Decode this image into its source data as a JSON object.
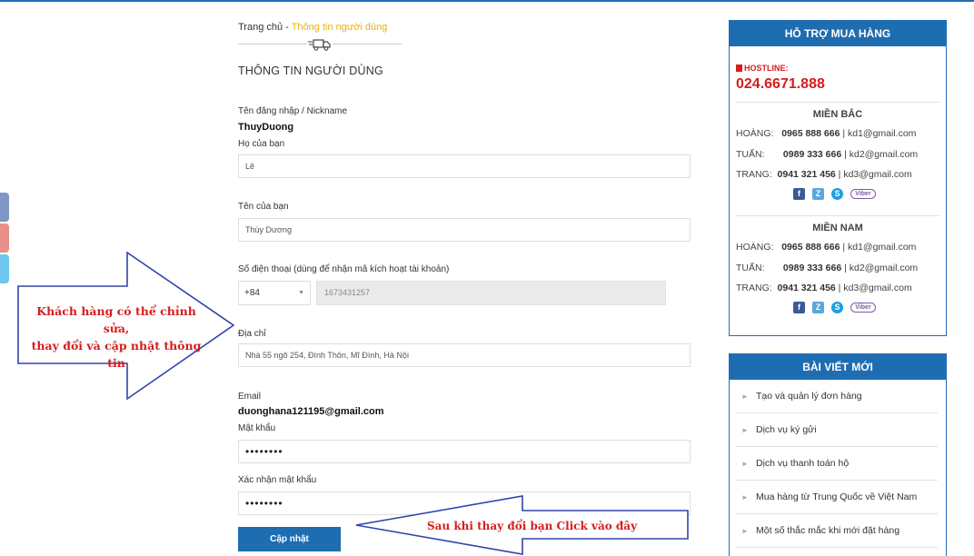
{
  "breadcrumb": {
    "home": "Trang chủ",
    "sep": " - ",
    "current": "Thông tin người dùng"
  },
  "page_title": "THÔNG TIN NGƯỜI DÙNG",
  "form": {
    "username_label": "Tên đăng nhập / Nickname",
    "username_value": "ThuyDuong",
    "lastname_label": "Họ của bạn",
    "lastname_value": "Lê",
    "firstname_label": "Tên của bạn",
    "firstname_value": "Thùy Dương",
    "phone_label": "Số điện thoại (dùng để nhận mã kích hoạt tài khoản)",
    "phone_code": "+84",
    "phone_value": "1673431257",
    "address_label": "Địa chỉ",
    "address_value": "Nhà 55 ngõ 254, Đình Thôn, Mĩ Đình, Hà Nội",
    "email_label": "Email",
    "email_value": "duonghana121195@gmail.com",
    "password_label": "Mật khẩu",
    "password_value": "••••••••",
    "confirm_label": "Xác nhận mật khẩu",
    "confirm_value": "••••••••",
    "submit_label": "Cập nhật"
  },
  "annotations": {
    "left_line1": "Khách hàng có thể chỉnh sửa,",
    "left_line2": "thay đổi và cập nhật thông tin",
    "bottom": "Sau khi thay đổi bạn Click vào đây",
    "color": "#d61d1d",
    "arrow_color": "#3344aa"
  },
  "support": {
    "title": "HỖ TRỢ MUA HÀNG",
    "hotline_label": "HOSTLINE:",
    "hotline": "024.6671.888",
    "north": {
      "title": "MIỀN BẮC",
      "contacts": [
        {
          "name": "HOÀNG:",
          "phone": "0965 888 666",
          "email": "| kd1@gmail.com"
        },
        {
          "name": "TUẤN:",
          "phone": "0989 333 666",
          "email": "| kd2@gmail.com"
        },
        {
          "name": "TRANG:",
          "phone": "0941 321 456",
          "email": "| kd3@gmail.com"
        }
      ]
    },
    "south": {
      "title": "MIỀN NAM",
      "contacts": [
        {
          "name": "HOÀNG:",
          "phone": "0965 888 666",
          "email": "| kd1@gmail.com"
        },
        {
          "name": "TUẤN:",
          "phone": "0989 333 666",
          "email": "| kd2@gmail.com"
        },
        {
          "name": "TRANG:",
          "phone": "0941 321 456",
          "email": "| kd3@gmail.com"
        }
      ]
    },
    "icons": [
      "facebook-icon",
      "zalo-icon",
      "skype-icon",
      "viber-icon"
    ],
    "icon_glyphs": {
      "fb": "f",
      "zalo": "Z",
      "skype": "S",
      "viber": "Viber"
    }
  },
  "news": {
    "title": "BÀI VIẾT MỚI",
    "items": [
      "Tạo và quản lý đơn hàng",
      "Dịch vụ ký gửi",
      "Dịch vụ thanh toán hộ",
      "Mua hàng từ Trung Quốc về Việt Nam",
      "Một số thắc mắc khi mới đặt hàng"
    ]
  },
  "colors": {
    "brand": "#1f6db1",
    "breadcrumb_active": "#e8b400",
    "hotline": "#d61d1d"
  }
}
